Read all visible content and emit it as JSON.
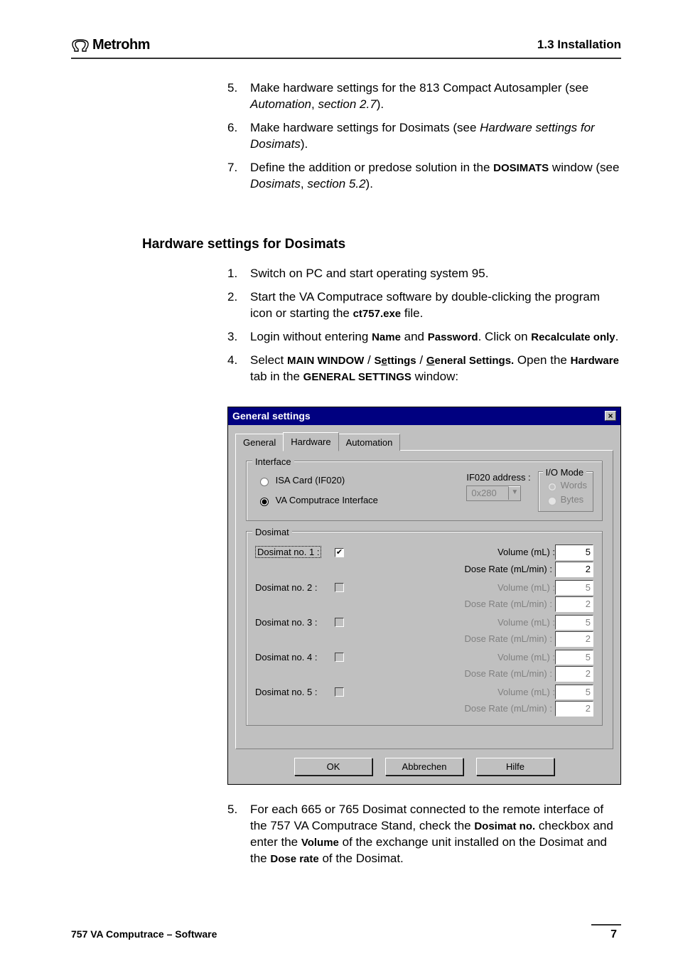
{
  "header": {
    "brand": "Metrohm",
    "section": "1.3  Installation"
  },
  "topList": [
    {
      "num": "5.",
      "html": "Make hardware settings for the 813 Compact Autosampler (see <span class=\"italic\">Automation</span>, <span class=\"italic\">section 2.7</span>)."
    },
    {
      "num": "6.",
      "html": "Make hardware settings for Dosimats (see <span class=\"italic\">Hardware settings for Dosimats</span>)."
    },
    {
      "num": "7.",
      "html": "Define the addition or predose solution in the <span class=\"smallbold\">DOSIMATS</span> window (see <span class=\"italic\">Dosimats</span>, <span class=\"italic\">section 5.2</span>)."
    }
  ],
  "sectionHeading": "Hardware settings for Dosimats",
  "midList": [
    {
      "num": "1.",
      "html": "Switch on PC and start operating system 95."
    },
    {
      "num": "2.",
      "html": "Start the VA Computrace software by double-clicking the program icon or starting the <span class=\"smallbold\">ct757.exe</span> file."
    },
    {
      "num": "3.",
      "html": "Login without entering <span class=\"smallbold\">Name</span> and <span class=\"smallbold\">Password</span>. Click on <span class=\"smallbold\">Recalculate only</span>."
    },
    {
      "num": "4.",
      "html": "Select <span class=\"smallbold\">MAIN WINDOW</span> / <span class=\"smallbold\">S<span class=\"u\">e</span>ttings</span> / <span class=\"smallbold\"><span class=\"u\">G</span>eneral Settings.</span> Open the <span class=\"smallbold\">Hardware</span> tab in the <span class=\"smallbold\">GENERAL SETTINGS</span> window:"
    }
  ],
  "dialog": {
    "title": "General settings",
    "tabs": {
      "general": "General",
      "hardware": "Hardware",
      "automation": "Automation"
    },
    "interface": {
      "legend": "Interface",
      "isa": "ISA Card (IF020)",
      "va": "VA Computrace Interface",
      "addrLabel": "IF020 address :",
      "addrValue": "0x280",
      "ioLegend": "I/O Mode",
      "ioWords": "Words",
      "ioBytes": "Bytes"
    },
    "dosimat": {
      "legend": "Dosimat",
      "volLabel": "Volume (mL) :",
      "rateLabel": "Dose Rate (mL/min) :",
      "rows": [
        {
          "name": "Dosimat no. 1 :",
          "enabled": true,
          "vol": "5",
          "rate": "2",
          "dotted": true
        },
        {
          "name": "Dosimat no. 2 :",
          "enabled": false,
          "vol": "5",
          "rate": "2"
        },
        {
          "name": "Dosimat no. 3 :",
          "enabled": false,
          "vol": "5",
          "rate": "2"
        },
        {
          "name": "Dosimat no. 4 :",
          "enabled": false,
          "vol": "5",
          "rate": "2"
        },
        {
          "name": "Dosimat no. 5 :",
          "enabled": false,
          "vol": "5",
          "rate": "2"
        }
      ]
    },
    "buttons": {
      "ok": "OK",
      "cancel": "Abbrechen",
      "help": "Hilfe"
    }
  },
  "afterList": [
    {
      "num": "5.",
      "html": "For each 665 or 765 Dosimat connected to the remote interface of the 757 VA Computrace Stand, check the <span class=\"smallbold\">Dosimat no.</span> checkbox and enter the <span class=\"smallbold\">Volume</span> of the exchange unit installed on the Dosimat and the <span class=\"smallbold\">Dose rate</span> of the Dosimat."
    }
  ],
  "footer": {
    "left": "757 VA Computrace – Software",
    "page": "7"
  }
}
